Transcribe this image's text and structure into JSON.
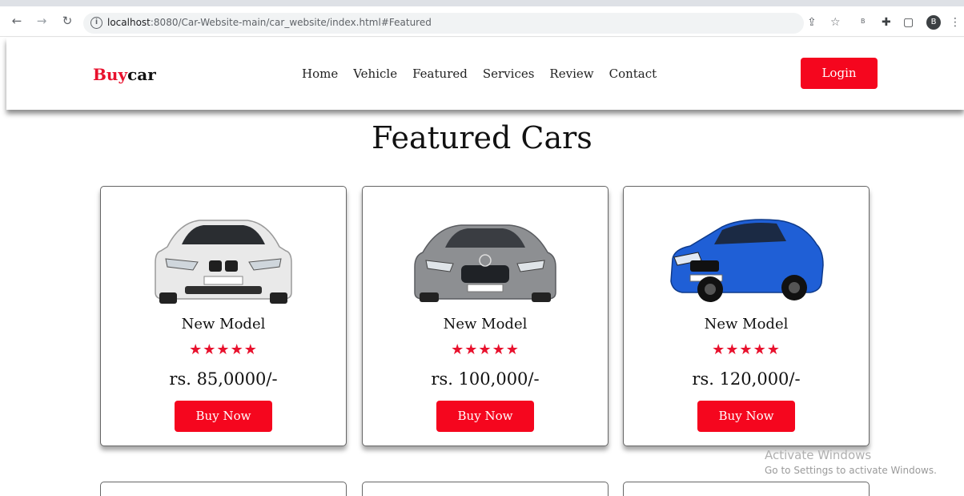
{
  "browser": {
    "url_host": "localhost",
    "url_path": ":8080/Car-Website-main/car_website/index.html#Featured",
    "extension_badge": "B",
    "profile_initial": "B"
  },
  "header": {
    "logo_part1": "Buy",
    "logo_part2": "car",
    "nav": [
      "Home",
      "Vehicle",
      "Featured",
      "Services",
      "Review",
      "Contact"
    ],
    "login_label": "Login"
  },
  "section": {
    "title": "Featured Cars"
  },
  "cards": [
    {
      "name": "New Model",
      "stars": "★★★★★",
      "rating": 5,
      "price": "rs. 85,0000/-",
      "button": "Buy Now",
      "car_color": "#e9e9e9"
    },
    {
      "name": "New Model",
      "stars": "★★★★★",
      "rating": 5,
      "price": "rs. 100,000/-",
      "button": "Buy Now",
      "car_color": "#8d8f92"
    },
    {
      "name": "New Model",
      "stars": "★★★★★",
      "rating": 5,
      "price": "rs. 120,000/-",
      "button": "Buy Now",
      "car_color": "#1f5fd6"
    }
  ],
  "watermark": {
    "line1": "Activate Windows",
    "line2": "Go to Settings to activate Windows."
  },
  "colors": {
    "accent": "#f5061e"
  }
}
